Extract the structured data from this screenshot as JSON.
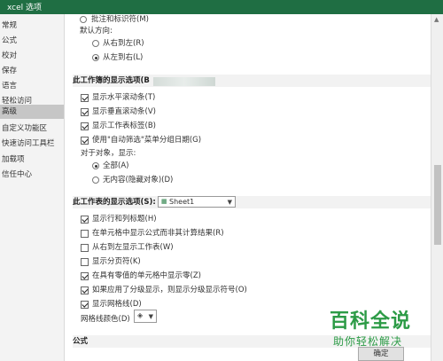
{
  "window": {
    "title": "xcel 选项"
  },
  "sidebar": {
    "items": [
      {
        "label": "常规"
      },
      {
        "label": "公式"
      },
      {
        "label": "校对"
      },
      {
        "label": "保存"
      },
      {
        "label": "语言"
      },
      {
        "label": "轻松访问"
      },
      {
        "label": "高级"
      },
      {
        "label": "自定义功能区"
      },
      {
        "label": "快速访问工具栏"
      },
      {
        "label": "加载项"
      },
      {
        "label": "信任中心"
      }
    ],
    "active": "高级"
  },
  "comments": {
    "option_none_indicators": "批注和标识符(M)"
  },
  "direction": {
    "label": "默认方向:",
    "rtl": "从右到左(R)",
    "ltr": "从左到右(L)"
  },
  "workbook_section": {
    "title": "此工作簿的显示选项(B",
    "items": [
      {
        "label": "显示水平滚动条(T)",
        "checked": true
      },
      {
        "label": "显示垂直滚动条(V)",
        "checked": true
      },
      {
        "label": "显示工作表标签(B)",
        "checked": true
      },
      {
        "label": "使用\"自动筛选\"菜单分组日期(G)",
        "checked": true
      }
    ],
    "objects_label": "对于对象，显示:",
    "objects_all": "全部(A)",
    "objects_none": "无内容(隐藏对象)(D)"
  },
  "sheet_section": {
    "title": "此工作表的显示选项(S):",
    "sheet_select": "Sheet1",
    "items": [
      {
        "label": "显示行和列标题(H)",
        "checked": true
      },
      {
        "label": "在单元格中显示公式而非其计算结果(R)",
        "checked": false
      },
      {
        "label": "从右到左显示工作表(W)",
        "checked": false
      },
      {
        "label": "显示分页符(K)",
        "checked": false
      },
      {
        "label": "在具有零值的单元格中显示零(Z)",
        "checked": true
      },
      {
        "label": "如果应用了分级显示，则显示分级显示符号(O)",
        "checked": true
      },
      {
        "label": "显示网格线(D)",
        "checked": true
      }
    ],
    "gridline_color_label": "网格线颜色(D)"
  },
  "formulas_section": {
    "title": "公式"
  },
  "footer": {
    "ok_label": "确定"
  },
  "watermark": {
    "line1": "百科全说",
    "line2": "助你轻松解决"
  },
  "colors": {
    "title_bar": "#1f6e43",
    "watermark": "#2c9b46"
  }
}
